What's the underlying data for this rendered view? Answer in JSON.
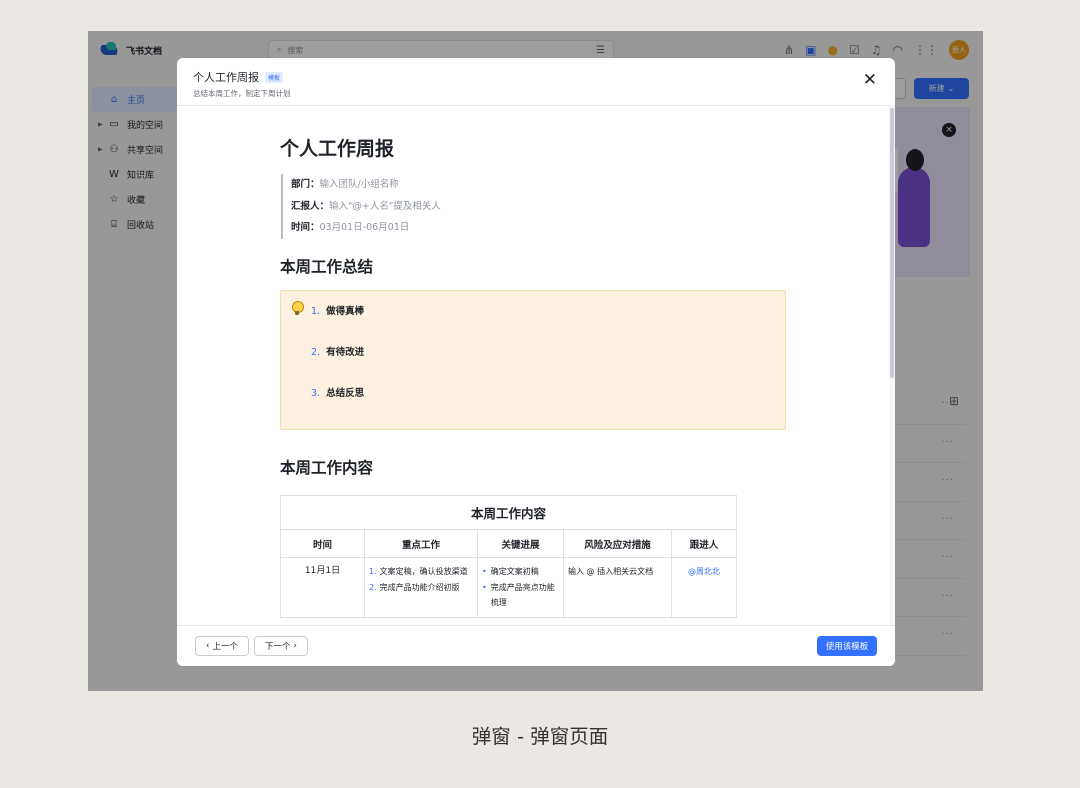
{
  "app": {
    "brand": "飞书文档",
    "search_placeholder": "搜索",
    "avatar_text": "鹿人",
    "new_button": "新建",
    "nav": [
      {
        "label": "主页"
      },
      {
        "label": "我的空间"
      },
      {
        "label": "共享空间"
      },
      {
        "label": "知识库"
      },
      {
        "label": "收藏"
      },
      {
        "label": "回收站"
      }
    ]
  },
  "modal": {
    "title": "个人工作周报",
    "tag": "模板",
    "subtitle": "总结本周工作，制定下周计划",
    "doc": {
      "title": "个人工作周报",
      "meta": [
        {
          "label": "部门：",
          "value": "输入团队/小组名称"
        },
        {
          "label": "汇报人：",
          "value": "输入\"@+人名\"提及相关人"
        },
        {
          "label": "时间：",
          "value": "03月01日-06月01日"
        }
      ],
      "section1": "本周工作总结",
      "summary_items": [
        {
          "num": "1.",
          "text": "做得真棒"
        },
        {
          "num": "2.",
          "text": "有待改进"
        },
        {
          "num": "3.",
          "text": "总结反思"
        }
      ],
      "section2": "本周工作内容",
      "table": {
        "caption": "本周工作内容",
        "headers": [
          "时间",
          "重点工作",
          "关键进展",
          "风险及应对措施",
          "跟进人"
        ],
        "row": {
          "date": "11月1日",
          "focus": [
            {
              "num": "1.",
              "text": "文案定稿，确认投放渠道"
            },
            {
              "num": "2.",
              "text": "完成产品功能介绍初版"
            }
          ],
          "progress": [
            {
              "dot": "•",
              "text": "确定文案初稿"
            },
            {
              "dot": "•",
              "text": "完成产品亮点功能梳理"
            }
          ],
          "risk": "输入 @ 插入相关云文档",
          "owner": "@周北北"
        }
      }
    },
    "footer": {
      "prev": "上一个",
      "next": "下一个",
      "use": "使用该模板"
    }
  },
  "caption": "弹窗 - 弹窗页面"
}
